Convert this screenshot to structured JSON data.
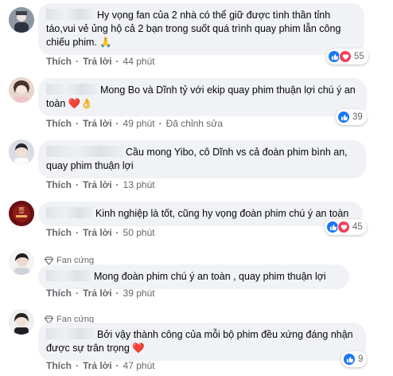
{
  "actions": {
    "like": "Thích",
    "reply": "Trả lời"
  },
  "comments": [
    {
      "text": "Hy vọng fan của 2 nhà có thể giữ được tình thần tỉnh táo,vui vẻ ủng hộ cả 2 bạn trong suốt quá trình quay phim lẫn công chiếu phim. 🙏",
      "time": "44 phút",
      "reaction_count": "55",
      "reactions": [
        "like",
        "love"
      ]
    },
    {
      "text": "Mong Bo và Dĩnh tỷ với ekip quay phim thuận lợi chú ý an toàn ❤️👌",
      "time": "49 phút",
      "edited": "Đã chỉnh sửa",
      "reaction_count": "39",
      "reactions": [
        "like"
      ]
    },
    {
      "text": "Cầu mong Yibo, cô Dĩnh vs cả đoàn phim bình an, quay phim thuận lợi",
      "time": "13 phút"
    },
    {
      "text": "Kinh nghiệp là tốt, cũng hy vọng đoàn phim chú ý an toàn",
      "time": "50 phút",
      "reaction_count": "45",
      "reactions": [
        "like",
        "love"
      ]
    },
    {
      "badge": "Fan cứng",
      "text": "Mong đoàn phim chú ý an toàn , quay phim thuận lợi",
      "time": "39 phút"
    },
    {
      "badge": "Fan cứng",
      "text": "Bởi vậy thành công của mỗi bộ phim đều xứng đáng nhận được sự trân trọng ❤️",
      "time": "47 phút",
      "reaction_count": "9",
      "reactions": [
        "like"
      ]
    }
  ],
  "colors": {
    "bubble": "#f0f2f5",
    "meta": "#65676b",
    "like": "#1877f2",
    "love": "#f33e58"
  }
}
